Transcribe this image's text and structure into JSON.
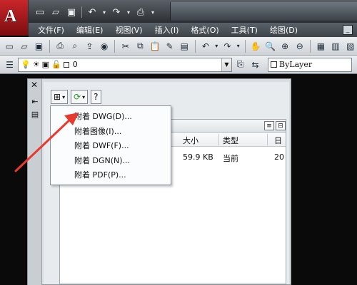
{
  "app": {
    "logo_letter": "A",
    "quick_access_icons": [
      "new-icon",
      "open-icon",
      "save-icon",
      "undo-icon",
      "redo-icon",
      "print-icon"
    ]
  },
  "menubar": {
    "items": [
      "文件(F)",
      "编辑(E)",
      "视图(V)",
      "插入(I)",
      "格式(O)",
      "工具(T)",
      "绘图(D)"
    ]
  },
  "layer_toolbar": {
    "layer_name": "0",
    "linetype_label": "ByLayer"
  },
  "palette": {
    "table": {
      "headers": [
        "大小",
        "类型",
        "日"
      ],
      "row": {
        "size": "59.9 KB",
        "type": "当前",
        "date_partial": "20"
      }
    }
  },
  "attach_menu": {
    "items": [
      "附着 DWG(D)...",
      "附着图像(I)...",
      "附着 DWF(F)...",
      "附着 DGN(N)...",
      "附着 PDF(P)..."
    ]
  },
  "colors": {
    "app_red": "#c9262a",
    "annotation_arrow": "#e8392f",
    "menubar_bg": "#4a5157"
  }
}
